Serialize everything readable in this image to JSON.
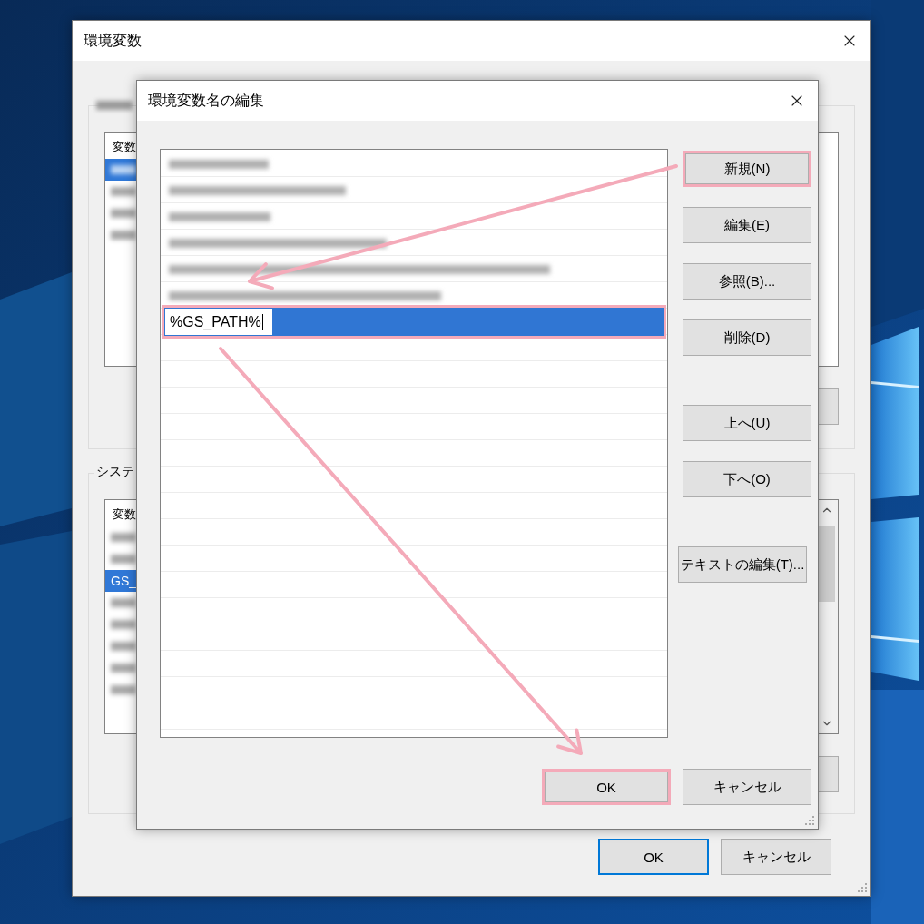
{
  "outer_window": {
    "title": "環境変数",
    "user_group": {
      "label": {
        "kind": "blurred"
      },
      "list": {
        "header": "変数",
        "rows": [
          {
            "kind": "blurred",
            "selected": true
          },
          {
            "kind": "blurred",
            "selected": false
          },
          {
            "kind": "blurred",
            "selected": false
          },
          {
            "kind": "blurred",
            "selected": false
          }
        ]
      },
      "partial_button": {
        "kind": "button"
      }
    },
    "system_group": {
      "label": "システ",
      "list": {
        "header": "変数",
        "rows": [
          {
            "kind": "blurred",
            "selected": false
          },
          {
            "kind": "blurred",
            "selected": false
          },
          {
            "kind": "text",
            "text": "GS_",
            "selected": true
          },
          {
            "kind": "blurred",
            "selected": false
          },
          {
            "kind": "blurred",
            "selected": false
          },
          {
            "kind": "blurred",
            "selected": false
          },
          {
            "kind": "blurred",
            "selected": false
          },
          {
            "kind": "blurred",
            "selected": false
          }
        ]
      },
      "partial_button": {
        "kind": "button"
      }
    },
    "buttons": [
      {
        "label": "OK",
        "default": true
      },
      {
        "label": "キャンセル",
        "default": false
      }
    ]
  },
  "edit_dialog": {
    "title": "環境変数名の編集",
    "list": {
      "rows": [
        {
          "kind": "blurred",
          "selected": false
        },
        {
          "kind": "blurred",
          "selected": false
        },
        {
          "kind": "blurred",
          "selected": false
        },
        {
          "kind": "blurred",
          "selected": false
        },
        {
          "kind": "blurred",
          "selected": false
        },
        {
          "kind": "blurred",
          "selected": false
        },
        {
          "kind": "edit",
          "value": "%GS_PATH%",
          "selected": true,
          "highlighted": true
        }
      ]
    },
    "button_groups": [
      [
        {
          "label": "新規(N)",
          "highlighted": true
        },
        {
          "label": "編集(E)",
          "highlighted": false
        },
        {
          "label": "参照(B)...",
          "highlighted": false
        },
        {
          "label": "削除(D)",
          "highlighted": false
        }
      ],
      [
        {
          "label": "上へ(U)",
          "highlighted": false
        },
        {
          "label": "下へ(O)",
          "highlighted": false
        }
      ],
      [
        {
          "label": "テキストの編集(T)...",
          "highlighted": false
        }
      ]
    ],
    "buttons": [
      {
        "label": "OK",
        "highlighted": true
      },
      {
        "label": "キャンセル",
        "highlighted": false
      }
    ]
  },
  "annotations": [
    {
      "kind": "arrow"
    },
    {
      "kind": "arrow"
    }
  ]
}
